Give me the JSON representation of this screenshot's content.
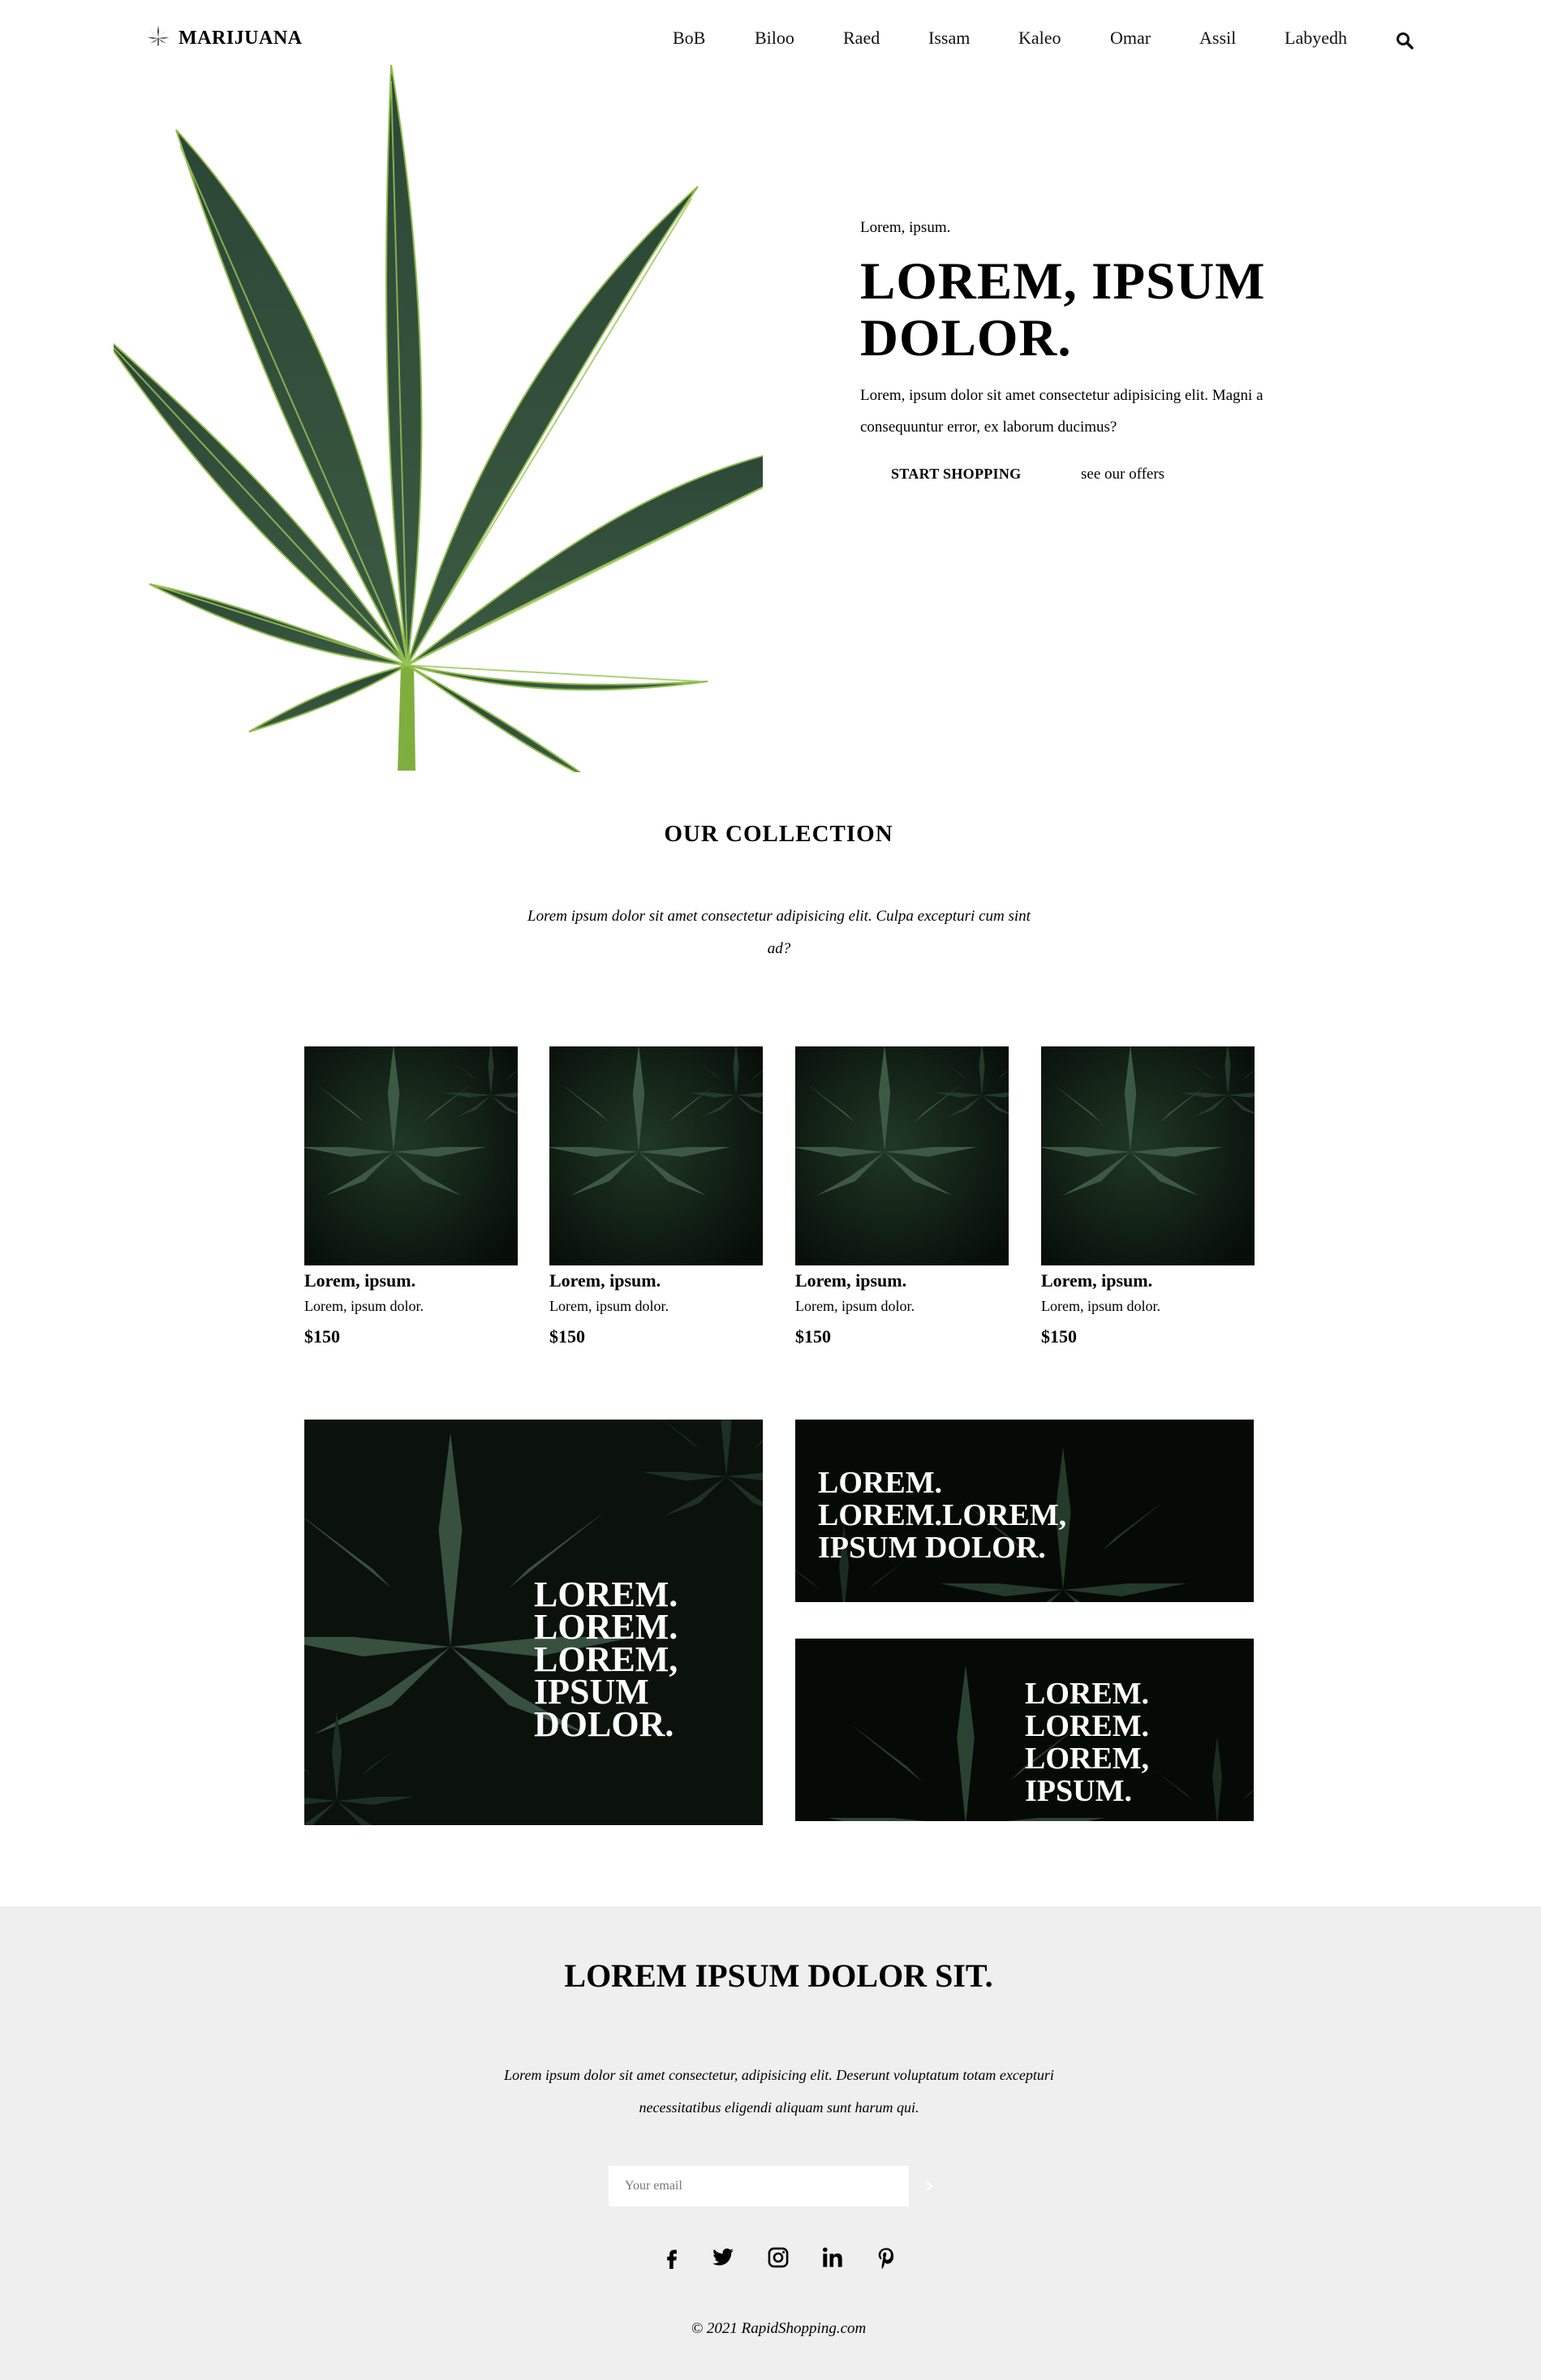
{
  "brand": {
    "name": "MARIJUANA"
  },
  "nav": {
    "items": [
      "BoB",
      "Biloo",
      "Raed",
      "Issam",
      "Kaleo",
      "Omar",
      "Assil",
      "Labyedh"
    ]
  },
  "hero": {
    "eyebrow": "Lorem, ipsum.",
    "title": "LOREM, IPSUM DOLOR.",
    "text": "Lorem, ipsum dolor sit amet consectetur adipisicing elit. Magni a consequuntur error, ex laborum ducimus?",
    "primary_cta": "START SHOPPING",
    "secondary_cta": "see our offers"
  },
  "collection": {
    "title": "OUR COLLECTION",
    "subtitle": "Lorem ipsum dolor sit amet consectetur adipisicing elit. Culpa excepturi cum sint ad?",
    "products": [
      {
        "name": "Lorem, ipsum.",
        "desc": "Lorem, ipsum dolor.",
        "price": "$150"
      },
      {
        "name": "Lorem, ipsum.",
        "desc": "Lorem, ipsum dolor.",
        "price": "$150"
      },
      {
        "name": "Lorem, ipsum.",
        "desc": "Lorem, ipsum dolor.",
        "price": "$150"
      },
      {
        "name": "Lorem, ipsum.",
        "desc": "Lorem, ipsum dolor.",
        "price": "$150"
      }
    ]
  },
  "banners": {
    "large": "LOREM.\nLOREM.\nLOREM,\nIPSUM\nDOLOR.",
    "top_right": "LOREM.\nLOREM.LOREM,\nIPSUM DOLOR.",
    "bottom_right": "LOREM.\nLOREM.\nLOREM,\nIPSUM."
  },
  "footer": {
    "title": "LOREM IPSUM DOLOR SIT.",
    "text": "Lorem ipsum dolor sit amet consectetur, adipisicing elit. Deserunt voluptatum totam excepturi necessitatibus eligendi aliquam sunt harum qui.",
    "email_placeholder": "Your email",
    "social": [
      "facebook-icon",
      "twitter-icon",
      "instagram-icon",
      "linkedin-icon",
      "pinterest-icon"
    ],
    "copyright": "© 2021 RapidShopping.com"
  },
  "colors": {
    "leaf_dark": "#2f4a37",
    "leaf_light": "#6a9a3a",
    "photo_bg": "#0c160e",
    "footer_bg": "#efefef"
  }
}
